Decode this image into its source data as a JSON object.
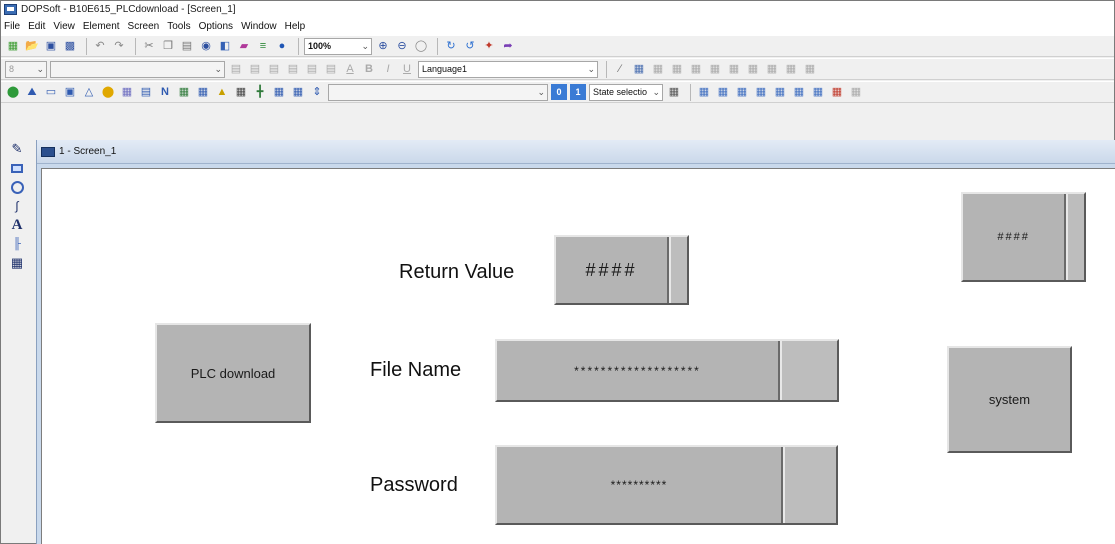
{
  "window": {
    "title": "DOPSoft - B10E615_PLCdownload - [Screen_1]"
  },
  "menu": [
    "File",
    "Edit",
    "View",
    "Element",
    "Screen",
    "Tools",
    "Options",
    "Window",
    "Help"
  ],
  "toolbar1": {
    "icons": [
      "new-file-icon",
      "open-folder-icon",
      "save-icon",
      "save-all-icon",
      "undo-icon",
      "redo-icon",
      "cut-icon",
      "copy-icon",
      "paste-icon",
      "find-icon",
      "compile-icon",
      "download-icon",
      "upload-icon",
      "info-icon"
    ],
    "zoom": "100%",
    "zoom_icons": [
      "zoom-in-icon",
      "zoom-out-icon",
      "zoom-fit-icon",
      "rotate-left-icon",
      "rotate-right-icon",
      "pointer-icon",
      "redo-arrow-icon"
    ]
  },
  "toolbar2": {
    "font_size": "8",
    "language": "Language1"
  },
  "toolbar3": {
    "state_select": "State selectio"
  },
  "screen": {
    "tab_label": "1 - Screen_1"
  },
  "hmi": {
    "return_label": "Return Value",
    "return_value": "####",
    "top_right_value": "####",
    "filename_label": "File Name",
    "filename_value": "*******************",
    "password_label": "Password",
    "password_value": "**********",
    "plc_button": "PLC download",
    "system_button": "system"
  },
  "colors": {
    "hmi_fill": "#b4b4b4",
    "canvas": "#ffffff",
    "screen_frame": "#c9d9ec"
  }
}
